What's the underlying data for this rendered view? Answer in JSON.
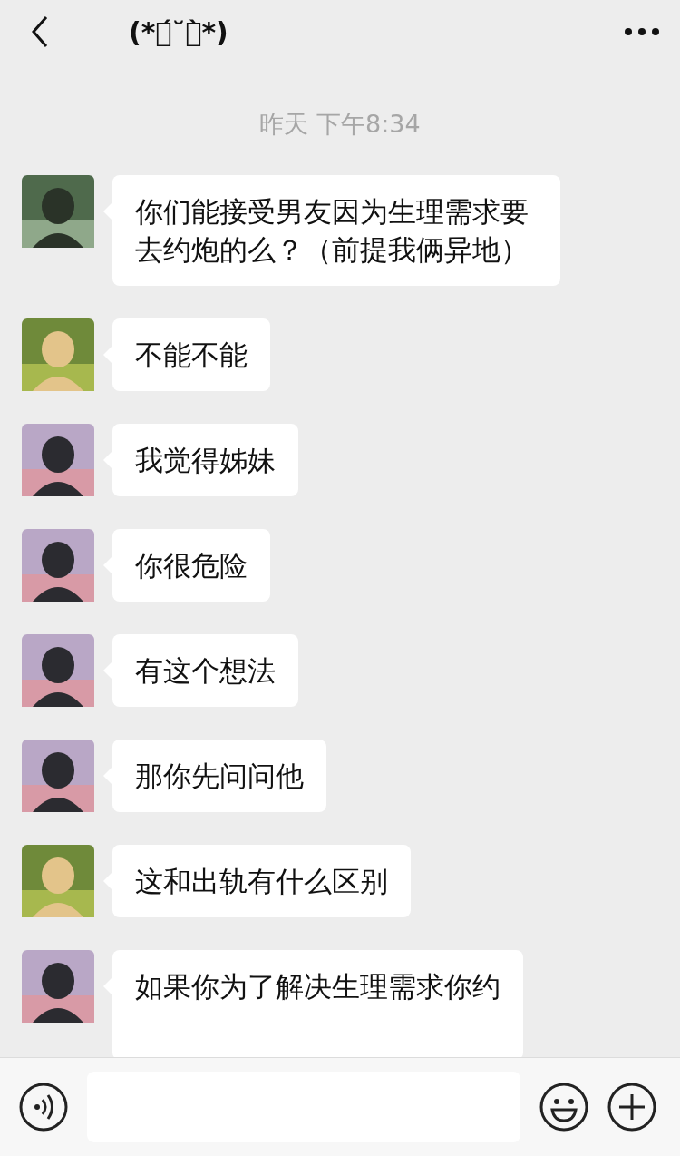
{
  "header": {
    "title": "(*ต́˘ต̀*)"
  },
  "timestamp": "昨天 下午8:34",
  "messages": [
    {
      "kind": "scene",
      "text": "你们能接受男友因为生理需求要去约炮的么？（前提我俩异地）"
    },
    {
      "kind": "light",
      "text": "不能不能"
    },
    {
      "kind": "dark",
      "text": "我觉得姊妹"
    },
    {
      "kind": "dark",
      "text": "你很危险"
    },
    {
      "kind": "dark",
      "text": "有这个想法"
    },
    {
      "kind": "dark",
      "text": "那你先问问他"
    },
    {
      "kind": "light",
      "text": "这和出轨有什么区别"
    },
    {
      "kind": "dark",
      "text": "如果你为了解决生理需求你约"
    }
  ]
}
